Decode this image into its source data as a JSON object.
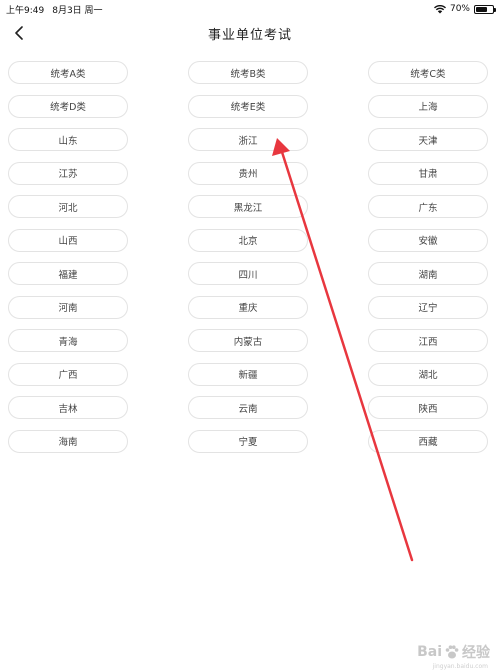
{
  "status": {
    "time": "上午9:49",
    "date": "8月3日 周一",
    "battery_text": "70%",
    "battery_level": 0.7
  },
  "header": {
    "title": "事业单位考试"
  },
  "options": [
    "统考A类",
    "统考B类",
    "统考C类",
    "统考D类",
    "统考E类",
    "上海",
    "山东",
    "浙江",
    "天津",
    "江苏",
    "贵州",
    "甘肃",
    "河北",
    "黑龙江",
    "广东",
    "山西",
    "北京",
    "安徽",
    "福建",
    "四川",
    "湖南",
    "河南",
    "重庆",
    "辽宁",
    "青海",
    "内蒙古",
    "江西",
    "广西",
    "新疆",
    "湖北",
    "吉林",
    "云南",
    "陕西",
    "海南",
    "宁夏",
    "西藏"
  ],
  "watermark": {
    "brand": "Bai",
    "brand_cn": "经验",
    "url": "jingyan.baidu.com"
  },
  "colors": {
    "annotation_arrow": "#e8373f",
    "button_border": "#e3e3e3"
  }
}
